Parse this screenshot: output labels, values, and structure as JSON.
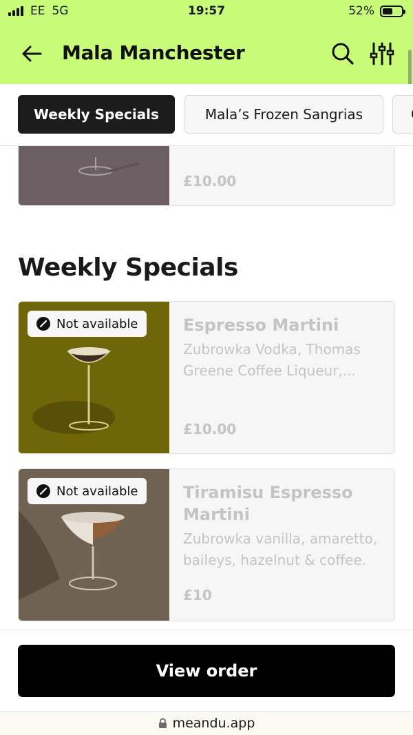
{
  "status_bar": {
    "carrier": "EE",
    "network": "5G",
    "time": "19:57",
    "battery": "52%"
  },
  "header": {
    "title": "Mala Manchester",
    "icons": [
      "back-arrow-icon",
      "search-icon",
      "filter-sliders-icon"
    ],
    "background": "#c8fb78"
  },
  "tabs": [
    {
      "label": "Weekly Specials",
      "active": true
    },
    {
      "label": "Mala’s Frozen Sangrias",
      "active": false
    },
    {
      "label": "C",
      "active": false
    }
  ],
  "content": {
    "previous_item": {
      "price": "£10.00"
    },
    "section_title": "Weekly Specials",
    "items": [
      {
        "name": "Espresso Martini",
        "description": "Zubrowka Vodka, Thomas Greene Coffee Liqueur,...",
        "price": "£10.00",
        "badge": "Not available"
      },
      {
        "name": "Tiramisu Espresso Martini",
        "description": "Zubrowka vanilla, amaretto, baileys, hazelnut & coffee.",
        "price": "£10",
        "badge": "Not available"
      }
    ]
  },
  "footer": {
    "view_order_label": "View order"
  },
  "browser": {
    "url": "meandu.app"
  }
}
